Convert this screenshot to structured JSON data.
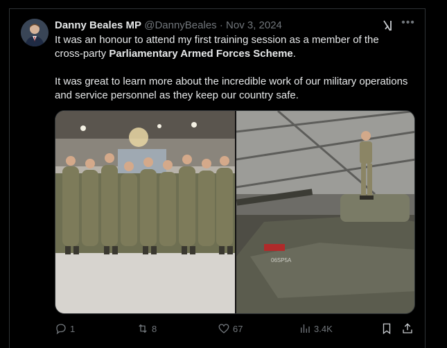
{
  "tweet": {
    "author_name": "Danny Beales MP",
    "handle": "@DannyBeales",
    "separator": "·",
    "date": "Nov 3, 2024",
    "text_part1": "It was an honour to attend my first training session as a member of the cross-party ",
    "text_bold": "Parliamentary Armed Forces Scheme",
    "text_part2": ".",
    "text_para2": "It was great to learn more about the incredible work of our military operations and service personnel as they keep our country safe.",
    "tank_marking": "06SP5A"
  },
  "actions": {
    "replies": "1",
    "reposts": "8",
    "likes": "67",
    "views": "3.4K"
  },
  "icons": {
    "reply": "reply-icon",
    "repost": "repost-icon",
    "like": "heart-icon",
    "views": "views-icon",
    "bookmark": "bookmark-icon",
    "share": "share-icon",
    "grok": "grok-icon",
    "more": "more-icon"
  },
  "colors": {
    "background": "#000000",
    "text": "#e7e9ea",
    "muted": "#71767b",
    "border": "#2f3336"
  }
}
